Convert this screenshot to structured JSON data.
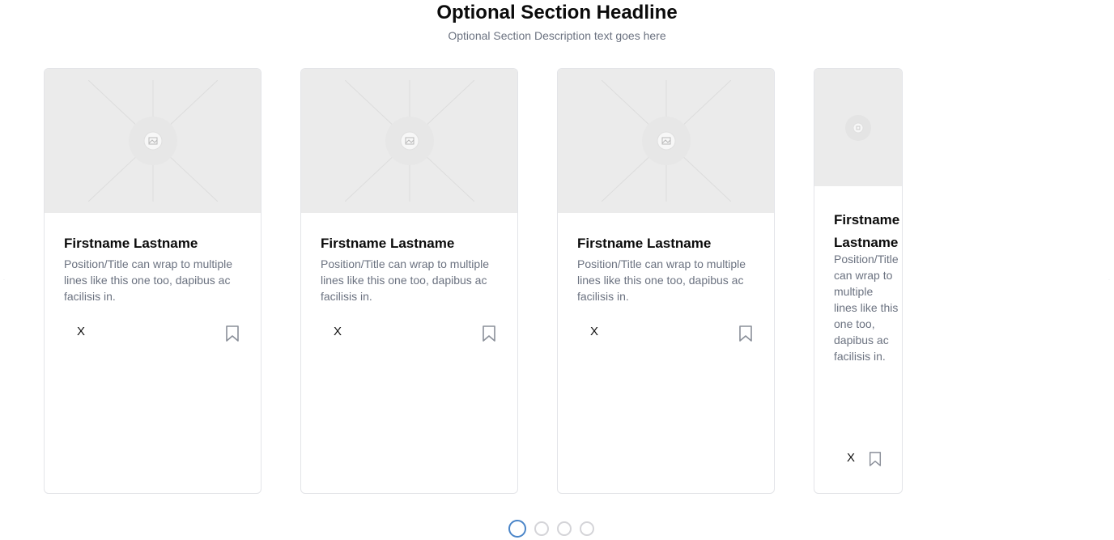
{
  "section": {
    "headline": "Optional Section Headline",
    "description": "Optional Section Description text goes here"
  },
  "cards": [
    {
      "name": "Firstname Lastname",
      "position": "Position/Title can wrap to multiple lines like this one too, dapibus ac facilisis in.",
      "social_label": "X",
      "image_icon": "image-placeholder-icon",
      "bookmark_icon": "bookmark-icon"
    },
    {
      "name": "Firstname Lastname",
      "position": "Position/Title can wrap to multiple lines like this one too, dapibus ac facilisis in.",
      "social_label": "X",
      "image_icon": "image-placeholder-icon",
      "bookmark_icon": "bookmark-icon"
    },
    {
      "name": "Firstname Lastname",
      "position": "Position/Title can wrap to multiple lines like this one too, dapibus ac facilisis in.",
      "social_label": "X",
      "image_icon": "image-placeholder-icon",
      "bookmark_icon": "bookmark-icon"
    },
    {
      "name": "Firstname Lastname",
      "position": "Position/Title can wrap to multiple lines like this one too, dapibus ac facilisis in.",
      "social_label": "X",
      "image_icon": "image-placeholder-icon",
      "bookmark_icon": "bookmark-icon"
    }
  ],
  "pagination": {
    "count": 4,
    "active_index": 0
  },
  "colors": {
    "image_background": "#ebebeb",
    "card_border": "#e3e4e8",
    "muted_text": "#6b7280",
    "active_dot": "#4a85c8",
    "inactive_dot": "#d4d4d8"
  }
}
